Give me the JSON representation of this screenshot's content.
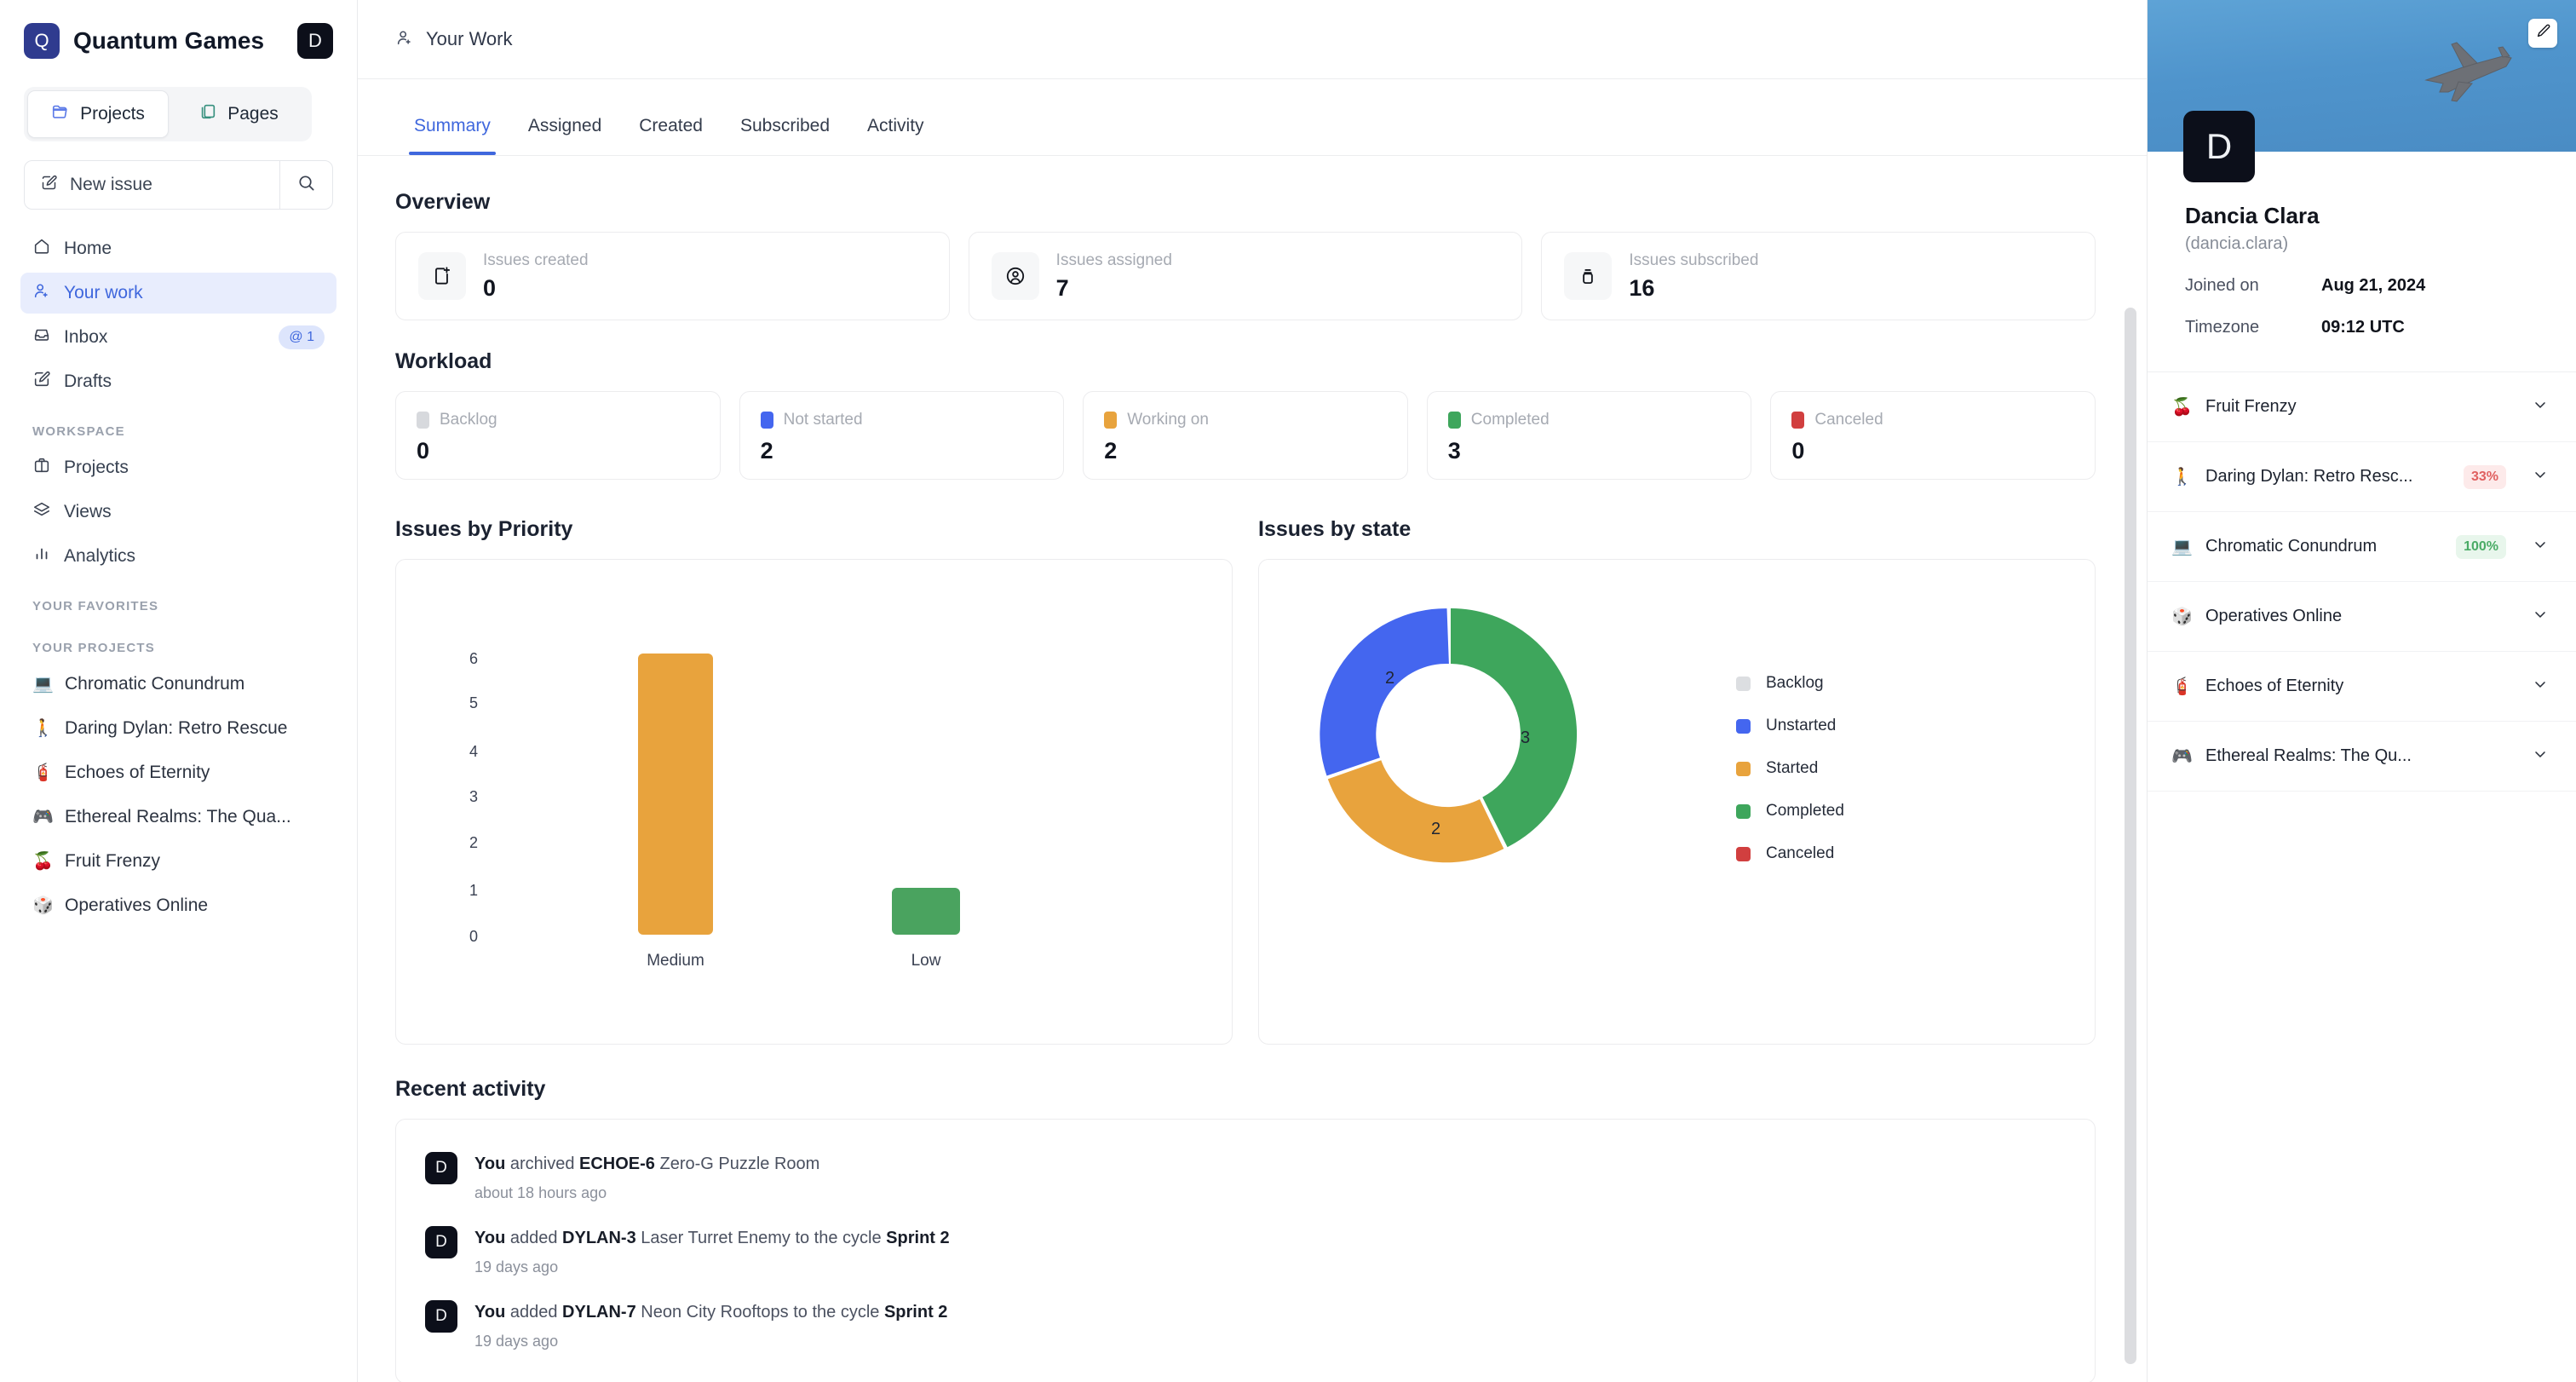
{
  "sidebar": {
    "workspace_name": "Quantum Games",
    "workspace_initial": "Q",
    "user_initial": "D",
    "segments": [
      {
        "label": "Projects",
        "icon": "folder-icon",
        "active": true
      },
      {
        "label": "Pages",
        "icon": "pages-icon",
        "active": false
      }
    ],
    "new_issue_label": "New issue",
    "search_icon": "search-icon",
    "nav": [
      {
        "label": "Home",
        "icon": "home-icon",
        "active": false,
        "badge": ""
      },
      {
        "label": "Your work",
        "icon": "user-plus-icon",
        "active": true,
        "badge": ""
      },
      {
        "label": "Inbox",
        "icon": "inbox-icon",
        "active": false,
        "badge": "@ 1"
      },
      {
        "label": "Drafts",
        "icon": "draft-icon",
        "active": false,
        "badge": ""
      }
    ],
    "workspace_section": "WORKSPACE",
    "workspace_items": [
      {
        "label": "Projects",
        "icon": "briefcase-icon"
      },
      {
        "label": "Views",
        "icon": "layers-icon"
      },
      {
        "label": "Analytics",
        "icon": "bars-icon"
      }
    ],
    "favorites_section": "YOUR FAVORITES",
    "projects_section": "YOUR PROJECTS",
    "projects": [
      {
        "emoji": "💻",
        "label": "Chromatic Conundrum"
      },
      {
        "emoji": "🚶",
        "label": "Daring Dylan: Retro Rescue"
      },
      {
        "emoji": "🧯",
        "label": "Echoes of Eternity"
      },
      {
        "emoji": "🎮",
        "label": "Ethereal Realms: The Qua..."
      },
      {
        "emoji": "🍒",
        "label": "Fruit Frenzy"
      },
      {
        "emoji": "🎲",
        "label": "Operatives Online"
      }
    ]
  },
  "main": {
    "header_title": "Your Work",
    "header_icon": "user-plus-icon",
    "tabs": [
      {
        "label": "Summary",
        "active": true
      },
      {
        "label": "Assigned",
        "active": false
      },
      {
        "label": "Created",
        "active": false
      },
      {
        "label": "Subscribed",
        "active": false
      },
      {
        "label": "Activity",
        "active": false
      }
    ],
    "overview_title": "Overview",
    "overview_cards": [
      {
        "label": "Issues created",
        "value": "0",
        "icon": "file-plus-icon"
      },
      {
        "label": "Issues assigned",
        "value": "7",
        "icon": "user-circle-icon"
      },
      {
        "label": "Issues subscribed",
        "value": "16",
        "icon": "bell-icon"
      }
    ],
    "workload_title": "Workload",
    "workload_cards": [
      {
        "label": "Backlog",
        "value": "0",
        "color": "#d7d9dd"
      },
      {
        "label": "Not started",
        "value": "2",
        "color": "#4466ef"
      },
      {
        "label": "Working on",
        "value": "2",
        "color": "#e8a33d"
      },
      {
        "label": "Completed",
        "value": "3",
        "color": "#3ea65c"
      },
      {
        "label": "Canceled",
        "value": "0",
        "color": "#d13f3f"
      }
    ],
    "recent_activity_title": "Recent activity",
    "activities": [
      {
        "avatar": "D",
        "actor": "You",
        "verb": " archived ",
        "ref": "ECHOE-6",
        "subject": " Zero-G Puzzle Room",
        "tail": "",
        "cycle": "",
        "time": "about 18 hours ago"
      },
      {
        "avatar": "D",
        "actor": "You",
        "verb": " added ",
        "ref": "DYLAN-3",
        "subject": " Laser Turret Enemy",
        "tail": " to the cycle ",
        "cycle": "Sprint 2",
        "time": "19 days ago"
      },
      {
        "avatar": "D",
        "actor": "You",
        "verb": " added ",
        "ref": "DYLAN-7",
        "subject": " Neon City Rooftops",
        "tail": " to the cycle ",
        "cycle": "Sprint 2",
        "time": "19 days ago"
      }
    ]
  },
  "chart_data": [
    {
      "type": "bar",
      "title": "Issues by Priority",
      "categories": [
        "Medium",
        "Low"
      ],
      "values": [
        6,
        1
      ],
      "colors": [
        "#e8a33d",
        "#4aa35f"
      ],
      "xlabel": "",
      "ylabel": "",
      "ylim": [
        0,
        6
      ],
      "yticks": [
        6,
        5,
        4,
        3,
        2,
        1,
        0
      ],
      "grid": false,
      "legend": "none"
    },
    {
      "type": "pie",
      "title": "Issues by state",
      "donut": true,
      "categories": [
        "Backlog",
        "Unstarted",
        "Started",
        "Completed",
        "Canceled"
      ],
      "values": [
        0,
        2,
        2,
        3,
        0
      ],
      "colors": [
        "#dcdee1",
        "#4466ef",
        "#e8a33d",
        "#3ea65c",
        "#d13f3f"
      ],
      "slice_labels": [
        "",
        "2",
        "2",
        "3",
        ""
      ],
      "legend": "right"
    }
  ],
  "right_panel": {
    "banner_image": "airplane-sky-photo",
    "edit_icon": "pencil-icon",
    "avatar_initial": "D",
    "name": "Dancia Clara",
    "handle": "(dancia.clara)",
    "joined_label": "Joined on",
    "joined_value": "Aug 21, 2024",
    "timezone_label": "Timezone",
    "timezone_value": "09:12 UTC",
    "projects": [
      {
        "emoji": "🍒",
        "label": "Fruit Frenzy",
        "pill": "",
        "pill_type": ""
      },
      {
        "emoji": "🚶",
        "label": "Daring Dylan: Retro Resc...",
        "pill": "33%",
        "pill_type": "red"
      },
      {
        "emoji": "💻",
        "label": "Chromatic Conundrum",
        "pill": "100%",
        "pill_type": "green"
      },
      {
        "emoji": "🎲",
        "label": "Operatives Online",
        "pill": "",
        "pill_type": ""
      },
      {
        "emoji": "🧯",
        "label": "Echoes of Eternity",
        "pill": "",
        "pill_type": ""
      },
      {
        "emoji": "🎮",
        "label": "Ethereal Realms: The Qu...",
        "pill": "",
        "pill_type": ""
      }
    ]
  }
}
